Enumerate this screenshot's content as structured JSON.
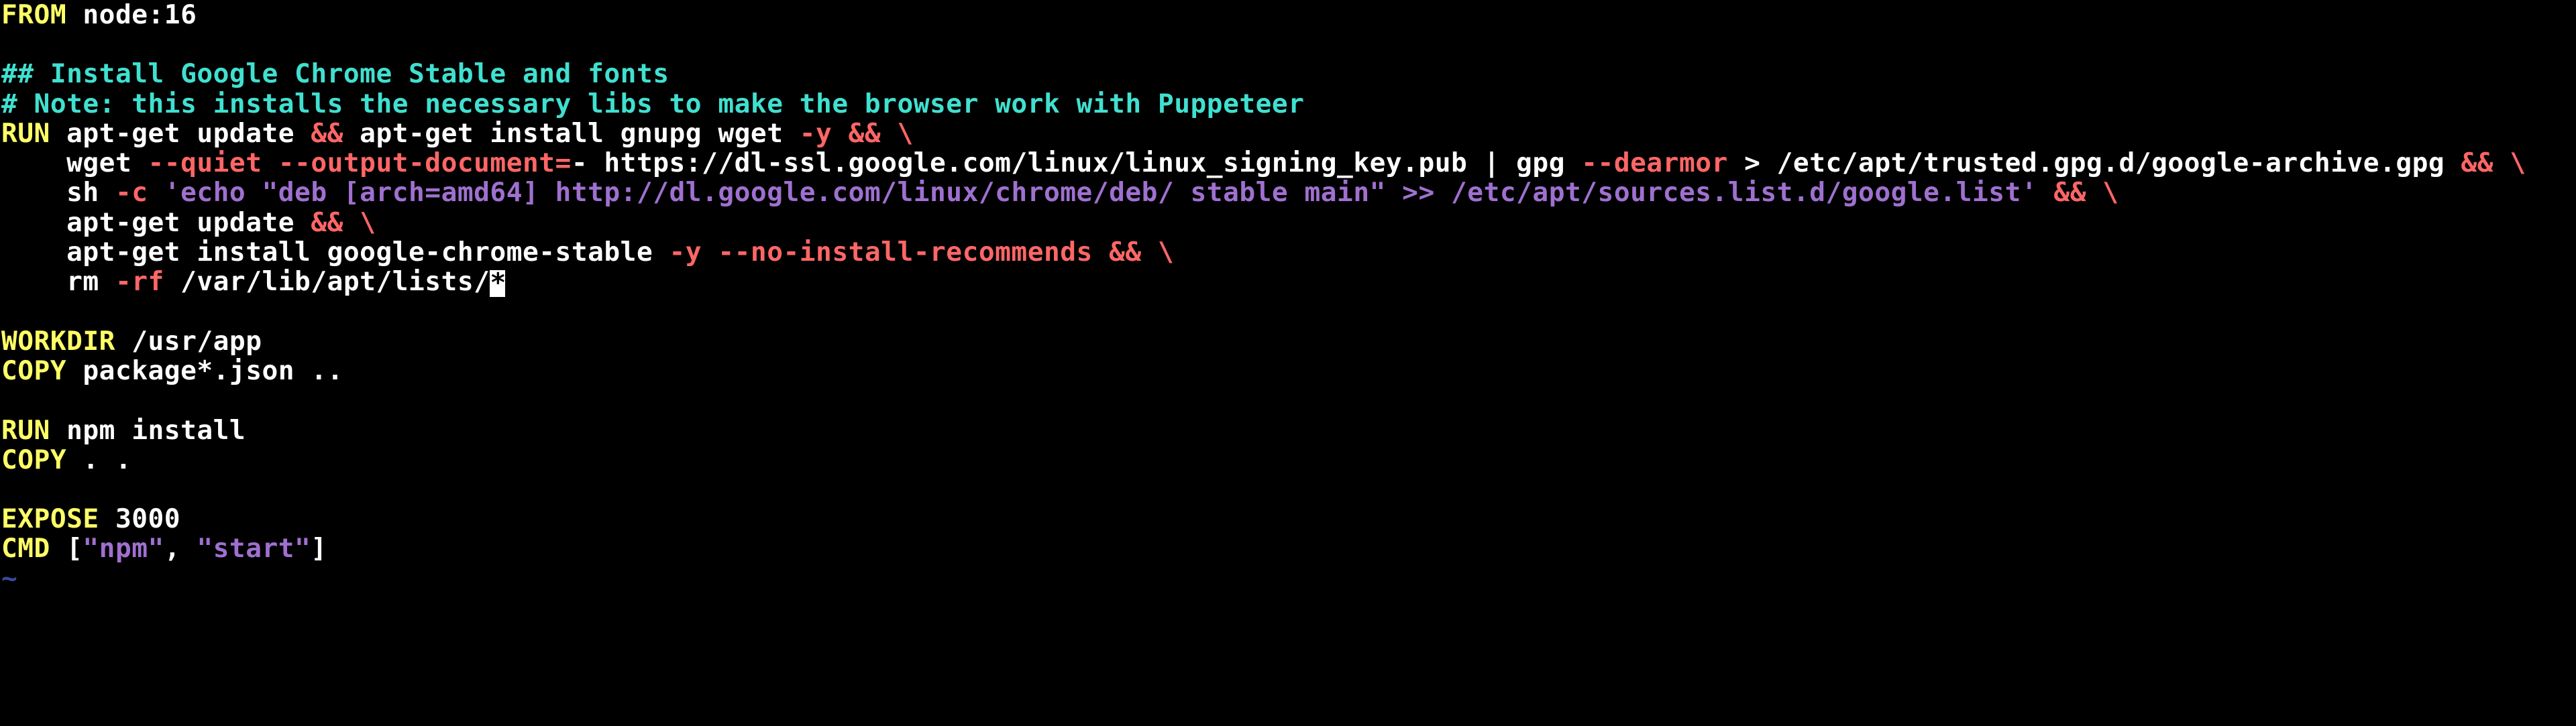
{
  "l0": {
    "kw": "FROM",
    "rest": " node:16"
  },
  "l1": "",
  "l2": {
    "cmt": "## Install Google Chrome Stable and fonts"
  },
  "l3": {
    "cmt": "# Note: this installs the necessary libs to make the browser work with Puppeteer"
  },
  "l4": {
    "kw": "RUN",
    "a": " apt-get update ",
    "op1": "&&",
    "b": " apt-get install gnupg wget ",
    "op2": "-y",
    "sp": " ",
    "op3": "&&",
    "sp2": " ",
    "op4": "\\"
  },
  "l5": {
    "pad": "    ",
    "a": "wget ",
    "op1": "--quiet --output-document=",
    "b": "- https://dl-ssl.google.com/linux/linux_signing_key.pub | gpg ",
    "op2": "--dearmor",
    "c": " > /etc/apt/trusted.gpg.d/google-archive.gpg ",
    "op3": "&&",
    "sp": " ",
    "op4": "\\"
  },
  "l6": {
    "pad": "    ",
    "a": "sh ",
    "op1": "-c",
    "sp": " ",
    "str": "'echo \"deb [arch=amd64] http://dl.google.com/linux/chrome/deb/ stable main\" >> /etc/apt/sources.list.d/google.list'",
    "sp2": " ",
    "op2": "&&",
    "sp3": " ",
    "op3": "\\"
  },
  "l7": {
    "pad": "    ",
    "a": "apt-get update ",
    "op1": "&&",
    "sp": " ",
    "op2": "\\"
  },
  "l8": {
    "pad": "    ",
    "a": "apt-get install google-chrome-stable ",
    "op1": "-y --no-install-recommends",
    "sp": " ",
    "op2": "&&",
    "sp2": " ",
    "op3": "\\"
  },
  "l9": {
    "pad": "    ",
    "a": "rm ",
    "op1": "-rf",
    "b": " /var/lib/apt/lists/",
    "cursor": "*"
  },
  "l10": "",
  "l11": {
    "kw": "WORKDIR",
    "rest": " /usr/app"
  },
  "l12": {
    "kw": "COPY",
    "rest": " package*.json .."
  },
  "l13": "",
  "l14": {
    "kw": "RUN",
    "rest": " npm install"
  },
  "l15": {
    "kw": "COPY",
    "rest": " . ."
  },
  "l16": "",
  "l17": {
    "kw": "EXPOSE",
    "rest": " 3000"
  },
  "l18": {
    "kw": "CMD",
    "sp": " ",
    "a": "[",
    "s1": "\"npm\"",
    "b": ", ",
    "s2": "\"start\"",
    "c": "]"
  },
  "tilde": "~"
}
